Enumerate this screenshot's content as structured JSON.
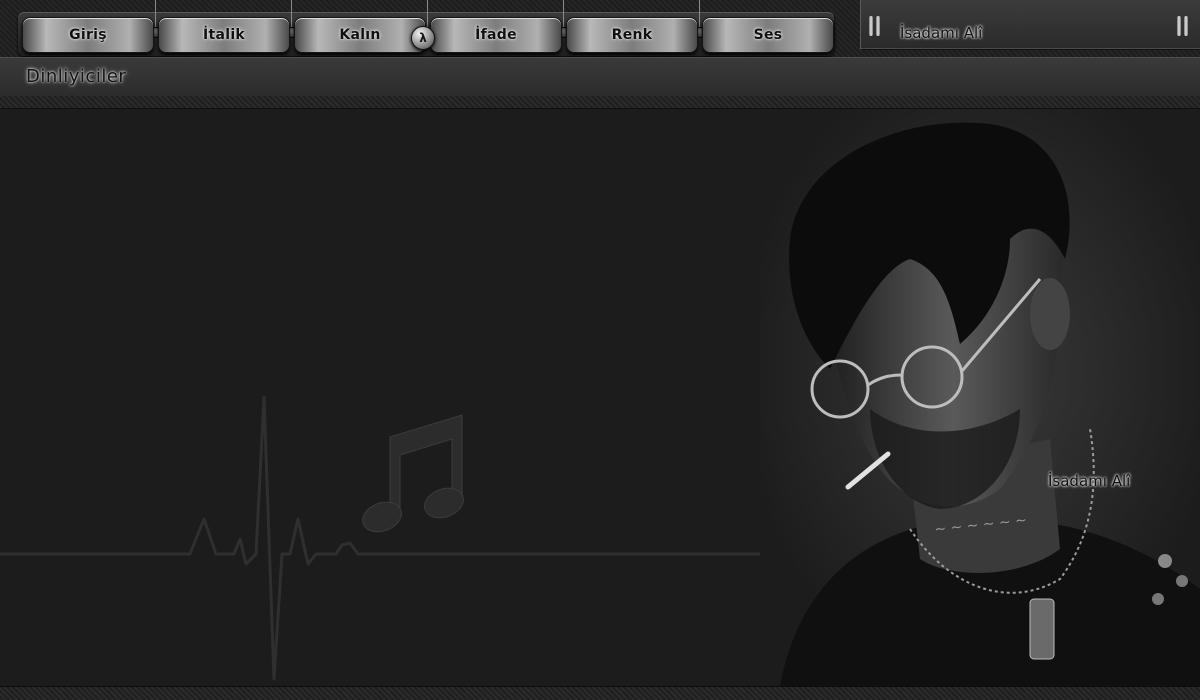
{
  "nav": {
    "tabs": [
      {
        "label": "Giriş"
      },
      {
        "label": "İtalik"
      },
      {
        "label": "Kalın"
      },
      {
        "label": "İfade"
      },
      {
        "label": "Renk"
      },
      {
        "label": "Ses"
      }
    ],
    "toggle_glyph": "λ"
  },
  "info_panel": {
    "watermark": "İsadamı Alî"
  },
  "section": {
    "title": "Dinliyiciler"
  },
  "main": {
    "portrait_watermark": "İsadamı Alî",
    "icons": [
      "heartbeat-line",
      "music-note-icon",
      "portrait-image"
    ]
  },
  "colors": {
    "background": "#1c1c1c",
    "panel": "#2e2e2e",
    "button_chrome": "#b8b8b8"
  }
}
